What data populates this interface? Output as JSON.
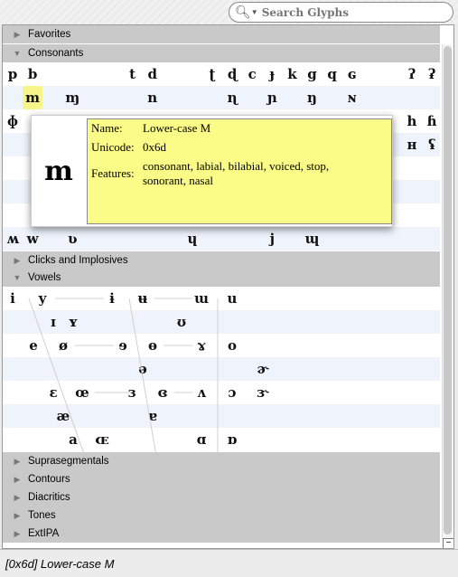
{
  "search": {
    "placeholder": "Search Glyphs",
    "icon": "magnifier-icon"
  },
  "sections": {
    "favorites": "Favorites",
    "consonants": "Consonants",
    "clicks": "Clicks and Implosives",
    "vowels": "Vowels",
    "collapsed": [
      "Suprasegmentals",
      "Contours",
      "Diacritics",
      "Tones",
      "ExtIPA"
    ]
  },
  "consonants": {
    "rows": [
      [
        "p",
        "b",
        "",
        "",
        "",
        "",
        "t",
        "d",
        "",
        "",
        "ʈ",
        "ɖ",
        "c",
        "ɟ",
        "k",
        "g",
        "q",
        "ɢ",
        "",
        "",
        "ʔ",
        "ʡ"
      ],
      [
        "",
        "m",
        "",
        "ɱ",
        "",
        "",
        "",
        "n",
        "",
        "",
        "",
        "ɳ",
        "",
        "ɲ",
        "",
        "ŋ",
        "",
        "ɴ",
        "",
        "",
        "",
        ""
      ],
      [
        "ɸ",
        "",
        "",
        "",
        "",
        "",
        "",
        "",
        "",
        "",
        "",
        "",
        "",
        "",
        "",
        "",
        "",
        "",
        "",
        "",
        "h",
        "ɦ"
      ],
      [
        "",
        "",
        "",
        "",
        "",
        "",
        "",
        "",
        "",
        "",
        "",
        "",
        "",
        "",
        "",
        "",
        "",
        "",
        "",
        "",
        "ʜ",
        "ʢ"
      ],
      [
        "",
        "",
        "",
        "",
        "",
        "",
        "",
        "",
        "",
        "",
        "",
        "",
        "",
        "",
        "",
        "",
        "",
        "",
        "",
        "",
        "",
        ""
      ],
      [
        "",
        "",
        "",
        "",
        "",
        "",
        "",
        "",
        "",
        "",
        "",
        "",
        "",
        "",
        "",
        "",
        "",
        "",
        "",
        "",
        "",
        ""
      ],
      [
        "",
        "",
        "",
        "",
        "",
        "",
        "",
        "",
        "",
        "",
        "",
        "",
        "",
        "",
        "",
        "",
        "",
        "",
        "",
        "",
        "",
        ""
      ],
      [
        "ʍ",
        "w",
        "",
        "ʋ",
        "",
        "",
        "",
        "",
        "",
        "ɥ",
        "",
        "",
        "",
        "j",
        "",
        "ɰ",
        "",
        "",
        "",
        "",
        "",
        ""
      ]
    ],
    "selected": "m"
  },
  "vowels": {
    "rows": [
      [
        "i",
        "y",
        "ɨ",
        "ʉ",
        "ɯ",
        "u"
      ],
      [
        "ɪ",
        "ʏ",
        "ʊ"
      ],
      [
        "e",
        "ø",
        "ɘ",
        "ɵ",
        "ɤ",
        "o"
      ],
      [
        "ə",
        "ɚ"
      ],
      [
        "ɛ",
        "œ",
        "ɜ",
        "ɞ",
        "ʌ",
        "ɔ",
        "ɝ"
      ],
      [
        "æ",
        "ɐ"
      ],
      [
        "a",
        "ɶ",
        "ɑ",
        "ɒ"
      ]
    ]
  },
  "tooltip": {
    "glyph": "m",
    "name_label": "Name:",
    "name": "Lower-case M",
    "unicode_label": "Unicode:",
    "unicode": "0x6d",
    "features_label": "Features:",
    "features": "consonant, labial, bilabial, voiced, stop, sonorant, nasal"
  },
  "status": "[0x6d] Lower-case M",
  "colors": {
    "header": "#c9c9c9",
    "alt_row": "#eef3fc",
    "tooltip": "#fbfb87",
    "selection": "#f7f48a"
  }
}
